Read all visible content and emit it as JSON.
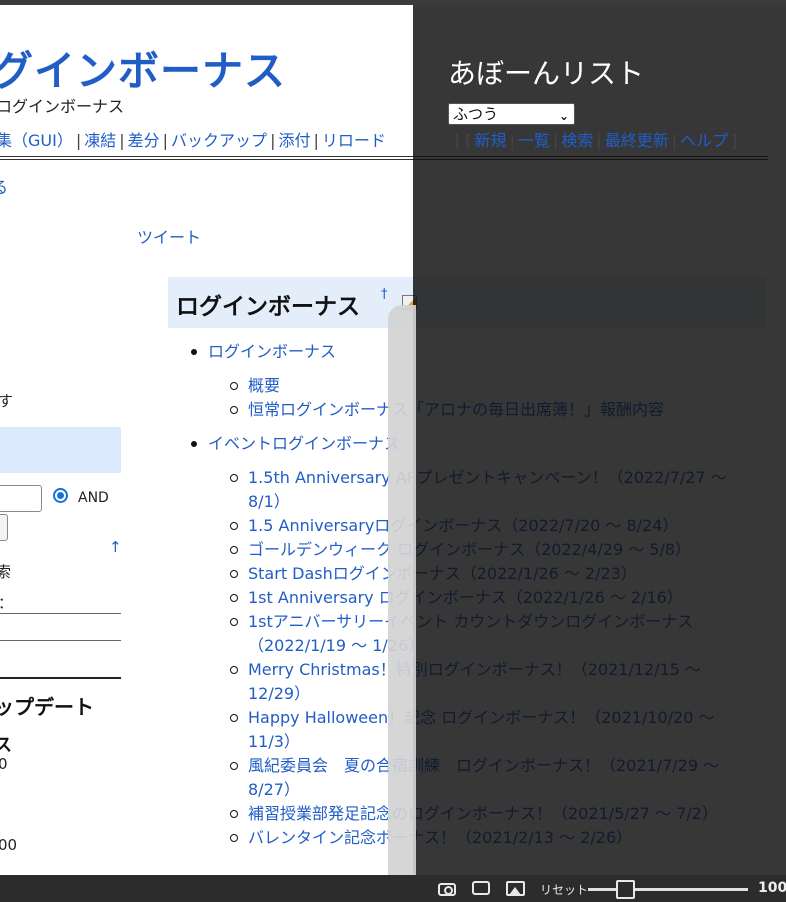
{
  "wiki": {
    "title": "グインボーナス",
    "subtitle": "ログインボーナス",
    "menu": [
      "集（GUI）",
      "凍結",
      "差分",
      "バックアップ",
      "添付",
      "リロード"
    ],
    "back_link": "る",
    "tweet": "ツイート"
  },
  "sidebar": {
    "frag_su": "す",
    "radio_label": "AND",
    "frag_search": "索",
    "frag_colon": "：",
    "update_heading": "ップデート",
    "update_s": "ス",
    "frag_0": "0",
    "frag_00": "00",
    "up_arrow": "↑"
  },
  "main": {
    "heading": "ログインボーナス",
    "heading_anchor": "†",
    "toc": [
      {
        "label": "ログインボーナス",
        "children": [
          "概要",
          "恒常ログインボーナス「アロナの毎日出席簿！」報酬内容"
        ]
      },
      {
        "label": "イベントログインボーナス",
        "children": [
          "1.5th Anniversary APプレゼントキャンペーン！（2022/7/27 ～ 8/1）",
          "1.5 Anniversaryログインボーナス（2022/7/20 ～ 8/24）",
          "ゴールデンウィーク ログインボーナス（2022/4/29 ～ 5/8）",
          "Start Dashログインボーナス（2022/1/26 ～ 2/23）",
          "1st Anniversary ログインボーナス（2022/1/26 ～ 2/16）",
          "1stアニバーサリーイベント カウントダウンログインボーナス（2022/1/19 ～ 1/26）",
          "Merry Christmas！特別ログインボーナス！（2021/12/15 ～ 12/29）",
          "Happy Halloween！記念 ログインボーナス！（2021/10/20 ～ 11/3）",
          "風紀委員会　夏の合宿訓練　ログインボーナス！（2021/7/29 ～ 8/27）",
          "補習授業部発足記念のログインボーナス！（2021/5/27 ～ 7/2）",
          "バレンタイン記念ボーナス！（2021/2/13 ～ 2/26）"
        ]
      }
    ]
  },
  "overlay": {
    "title": "あぼーんリスト",
    "select_value": "ふつう",
    "menu": [
      "新規",
      "一覧",
      "検索",
      "最終更新",
      "ヘルプ"
    ]
  },
  "bottombar": {
    "reset_label": "リセット",
    "zoom_value": "100",
    "zoom_fraction": 0.2
  }
}
